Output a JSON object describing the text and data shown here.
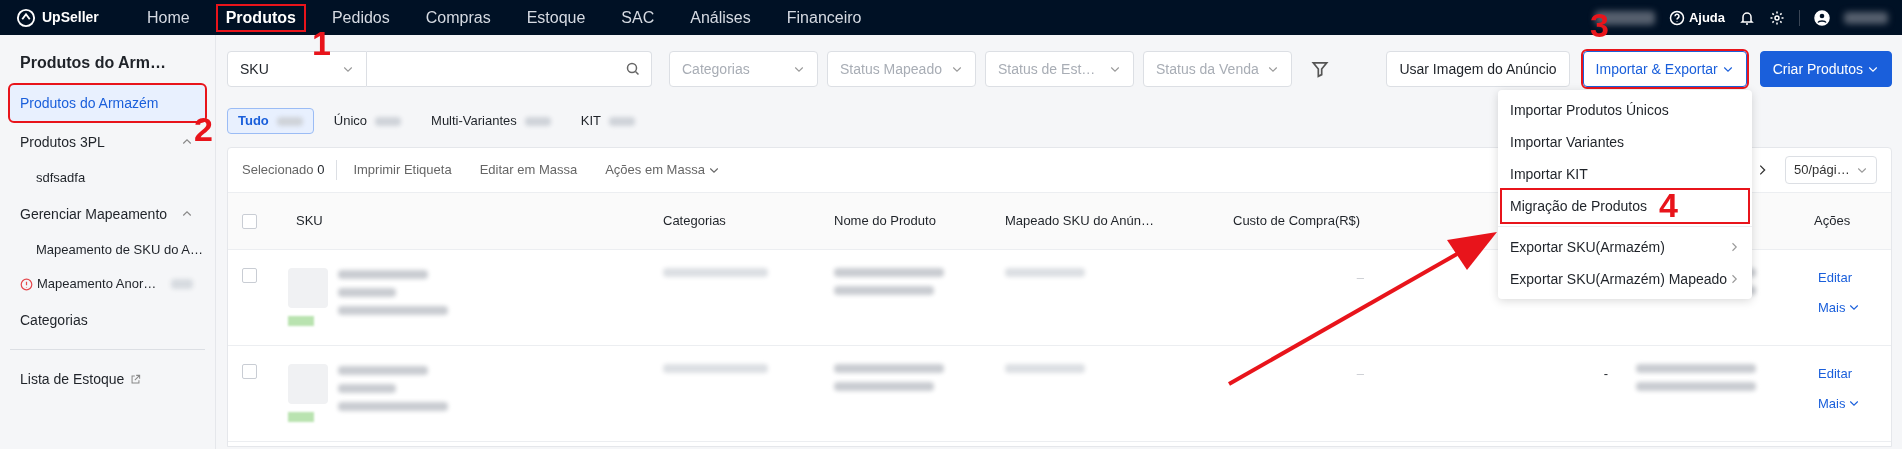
{
  "top_nav": {
    "logo": "UpSeller",
    "items": [
      {
        "label": "Home",
        "selected": false,
        "highlighted": false
      },
      {
        "label": "Produtos",
        "selected": true,
        "highlighted": true,
        "step": "1"
      },
      {
        "label": "Pedidos",
        "selected": false,
        "highlighted": false
      },
      {
        "label": "Compras",
        "selected": false,
        "highlighted": false
      },
      {
        "label": "Estoque",
        "selected": false,
        "highlighted": false
      },
      {
        "label": "SAC",
        "selected": false,
        "highlighted": false
      },
      {
        "label": "Análises",
        "selected": false,
        "highlighted": false
      },
      {
        "label": "Financeiro",
        "selected": false,
        "highlighted": false
      }
    ],
    "help": "Ajuda"
  },
  "sidebar": {
    "title": "Produtos do Arm…",
    "items": [
      {
        "kind": "item",
        "label": "Produtos do Armazém",
        "selected": true,
        "highlighted": true,
        "step": "2"
      },
      {
        "kind": "group",
        "label": "Produtos 3PL",
        "expanded": true,
        "children": [
          {
            "kind": "sub",
            "label": "sdfsadfa",
            "selected": false
          }
        ]
      },
      {
        "kind": "group",
        "label": "Gerenciar Mapeamento",
        "expanded": true,
        "children": [
          {
            "kind": "sub",
            "label": "Mapeamento de SKU do A…",
            "selected": false
          },
          {
            "kind": "warning",
            "label": "Mapeamento Anor…",
            "selected": false
          }
        ]
      },
      {
        "kind": "item",
        "label": "Categorias",
        "selected": false,
        "highlighted": false
      },
      {
        "kind": "external",
        "label": "Lista de Estoque",
        "selected": false,
        "highlighted": false
      }
    ]
  },
  "filters": {
    "search_type": "SKU",
    "selects": [
      "Categorias",
      "Status Mapeado",
      "Status de Est…",
      "Status da Venda"
    ]
  },
  "actions": [
    {
      "kind": "outline",
      "label": "Usar Imagem do Anúncio",
      "highlighted": false
    },
    {
      "kind": "menu-outline",
      "label": "Importar & Exportar",
      "highlighted": true,
      "step": "3"
    },
    {
      "kind": "primary",
      "label": "Criar Produtos",
      "highlighted": false
    }
  ],
  "menu": {
    "groups": [
      [
        {
          "label": "Importar Produtos Únicos",
          "submenu": false,
          "highlighted": false
        },
        {
          "label": "Importar Variantes",
          "submenu": false,
          "highlighted": false
        },
        {
          "label": "Importar KIT",
          "submenu": false,
          "highlighted": false
        },
        {
          "label": "Migração de Produtos",
          "submenu": false,
          "highlighted": true,
          "step": "4"
        }
      ],
      [
        {
          "label": "Exportar SKU(Armazém)",
          "submenu": true,
          "highlighted": false
        },
        {
          "label": "Exportar SKU(Armazém) Mapeado",
          "submenu": true,
          "highlighted": false
        }
      ]
    ]
  },
  "tabs": [
    {
      "label": "Tudo",
      "selected": true
    },
    {
      "label": "Único",
      "selected": false
    },
    {
      "label": "Multi-Variantes",
      "selected": false
    },
    {
      "label": "KIT",
      "selected": false
    }
  ],
  "toolbar": {
    "selected_label": "Selecionado",
    "selected_count": "0",
    "buttons": [
      {
        "label": "Imprimir Etiqueta",
        "dropdown": false
      },
      {
        "label": "Editar em Massa",
        "dropdown": false
      },
      {
        "label": "Ações em Massa",
        "dropdown": true
      }
    ],
    "page_size": "50/pági…"
  },
  "table": {
    "select_all_checked": false,
    "columns": [
      "SKU",
      "Categorias",
      "Nome do Produto",
      "Mapeado SKU do Anún…",
      "Custo de Compra(R$)",
      "Ações"
    ],
    "rows": [
      {
        "checked": false,
        "cost": "–",
        "actions": [
          "Editar",
          "Mais"
        ]
      },
      {
        "checked": false,
        "cost": "–",
        "column_6": "-",
        "actions": [
          "Editar",
          "Mais"
        ]
      }
    ]
  }
}
